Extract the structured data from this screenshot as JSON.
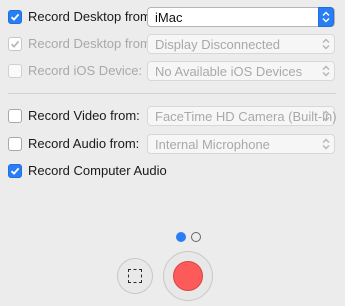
{
  "rows": {
    "record_desktop": {
      "label": "Record Desktop from:",
      "checked": true,
      "value": "iMac"
    },
    "record_desktop_2": {
      "label": "Record Desktop from:",
      "checked": true,
      "value": "Display Disconnected"
    },
    "record_ios": {
      "label": "Record iOS Device:",
      "checked": false,
      "value": "No Available iOS Devices"
    },
    "record_video": {
      "label": "Record Video from:",
      "checked": false,
      "value": "FaceTime HD Camera (Built-in)"
    },
    "record_audio": {
      "label": "Record Audio from:",
      "checked": false,
      "value": "Internal Microphone"
    },
    "record_computer_audio": {
      "label": "Record Computer Audio",
      "checked": true
    }
  },
  "pager": {
    "pages": 2,
    "current": 1
  },
  "colors": {
    "accent": "#2a7ef5",
    "record": "#fd5a5a",
    "background": "#ececec"
  },
  "icons": {
    "select_area": "dashed-rect-icon",
    "record": "record-icon"
  }
}
